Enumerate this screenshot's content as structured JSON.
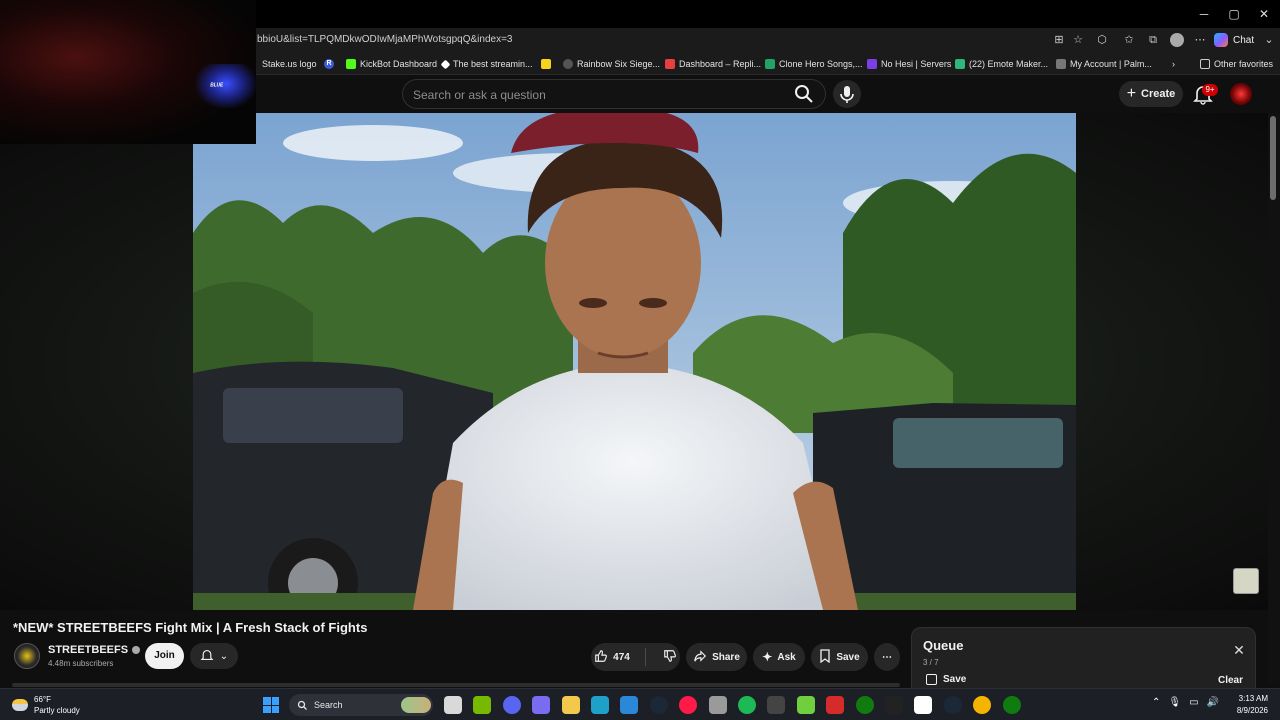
{
  "browser": {
    "url": "bbioU&list=TLPQMDkwODIwMjaMPhWotsgpqQ&index=3",
    "chat_label": "Chat",
    "window_controls": [
      "minimize",
      "maximize",
      "close"
    ]
  },
  "bookmarks": [
    {
      "label": "Stake.us logo",
      "color": "#1b1b1b"
    },
    {
      "label": "",
      "color": "#3b5bdb",
      "glyph": "R"
    },
    {
      "label": "KickBot Dashboard",
      "color": "#53fc18"
    },
    {
      "label": "The best streamin...",
      "color": "#ffffff"
    },
    {
      "label": "",
      "color": "#f7d51d"
    },
    {
      "label": "Rainbow Six Siege...",
      "color": "#888888"
    },
    {
      "label": "Dashboard – Repli...",
      "color": "#e83e3e"
    },
    {
      "label": "Clone Hero Songs,...",
      "color": "#21a366"
    },
    {
      "label": "No Hesi | Servers",
      "color": "#7b3fe4"
    },
    {
      "label": "(22) Emote Maker...",
      "color": "#2fb67c"
    },
    {
      "label": "My Account | Palm...",
      "color": "#777777"
    }
  ],
  "bookmarks_other": "Other favorites",
  "webcam": {
    "text": "ᴮᴸᵁᴱ"
  },
  "youtube": {
    "search_placeholder": "Search or ask a question",
    "create_label": "Create",
    "notification_badge": "9+"
  },
  "video": {
    "title": "*NEW* STREETBEEFS Fight Mix | A Fresh Stack of Fights",
    "channel_name": "STREETBEEFS",
    "subscribers": "4.48m subscribers",
    "join_label": "Join",
    "likes": "474",
    "share_label": "Share",
    "ask_label": "Ask",
    "save_label": "Save"
  },
  "queue": {
    "title": "Queue",
    "count": "3 / 7",
    "save_label": "Save",
    "clear_label": "Clear"
  },
  "taskbar": {
    "temperature": "66°F",
    "condition": "Partly cloudy",
    "search_label": "Search",
    "time": "3:13 AM",
    "date": "8/9/2026",
    "apps": [
      {
        "name": "file-explorer-blank",
        "color": "#d9d9d9"
      },
      {
        "name": "nvidia",
        "color": "#76b900"
      },
      {
        "name": "discord",
        "color": "#5865f2"
      },
      {
        "name": "copilot",
        "color": "#7a6cf0"
      },
      {
        "name": "folder",
        "color": "#f2c94c"
      },
      {
        "name": "edge",
        "color": "#1fa0c9"
      },
      {
        "name": "store",
        "color": "#2b88d8"
      },
      {
        "name": "steam",
        "color": "#1b2838"
      },
      {
        "name": "opera-gx",
        "color": "#ff1a4a"
      },
      {
        "name": "settings",
        "color": "#9a9a9a"
      },
      {
        "name": "spotify",
        "color": "#1db954"
      },
      {
        "name": "4k-downloader",
        "color": "#444"
      },
      {
        "name": "b-app",
        "color": "#6fcf3f"
      },
      {
        "name": "red-app",
        "color": "#d62b2b"
      },
      {
        "name": "xbox",
        "color": "#107c10"
      },
      {
        "name": "epic",
        "color": "#222"
      },
      {
        "name": "g-app",
        "color": "#ffffff"
      },
      {
        "name": "steam-2",
        "color": "#1b2838"
      },
      {
        "name": "chrome",
        "color": "#f4b400"
      },
      {
        "name": "xbox-2",
        "color": "#107c10"
      }
    ]
  }
}
